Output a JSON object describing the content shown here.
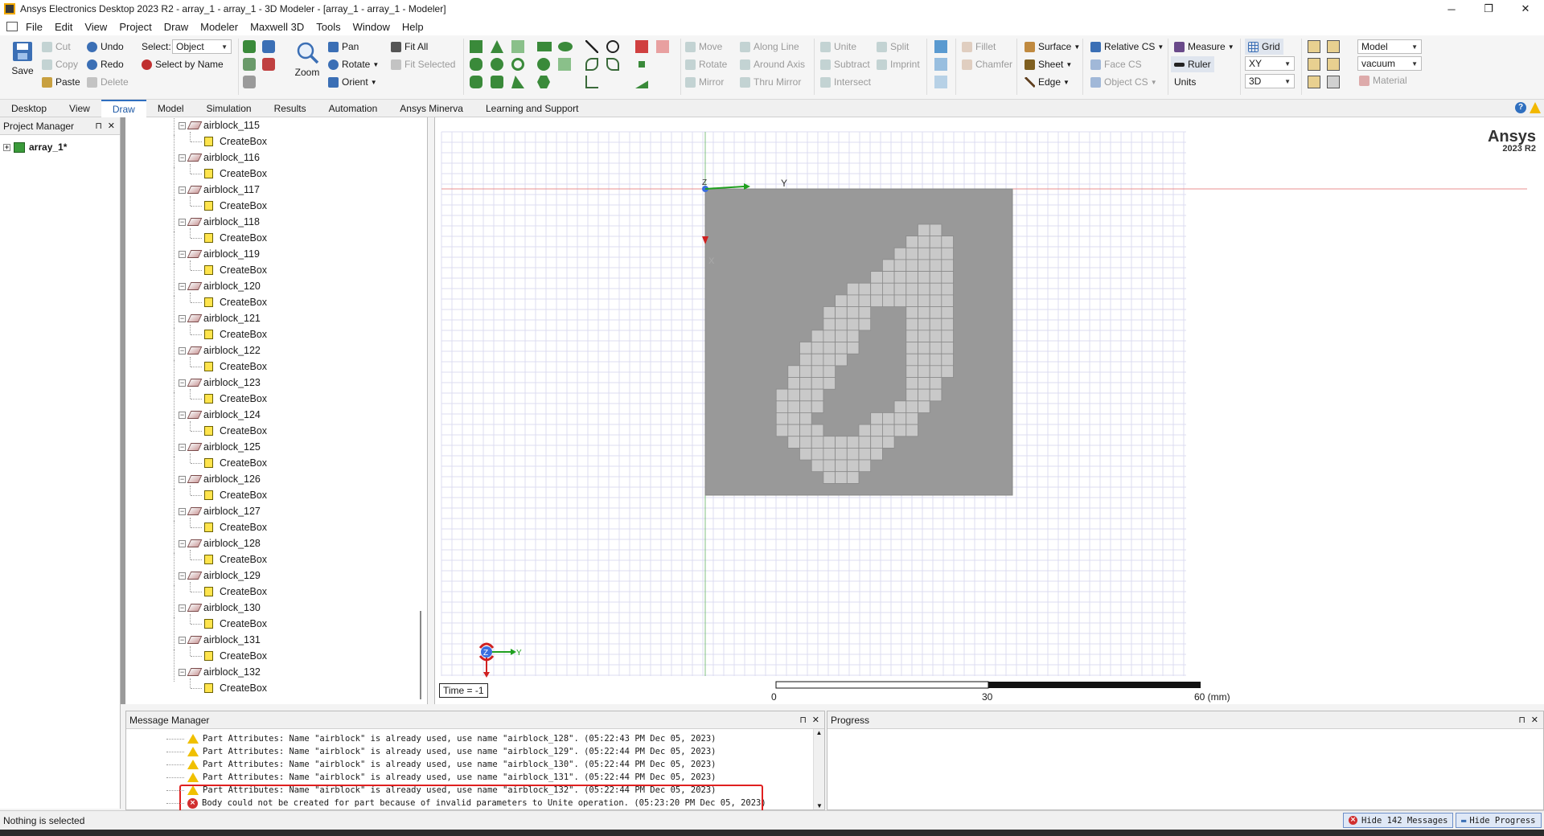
{
  "window": {
    "title": "Ansys Electronics Desktop 2023 R2 - array_1 - array_1 - 3D Modeler - [array_1 - array_1 - Modeler]",
    "minimize": "─",
    "restore": "❐",
    "close": "✕"
  },
  "menu": [
    "File",
    "Edit",
    "View",
    "Project",
    "Draw",
    "Modeler",
    "Maxwell 3D",
    "Tools",
    "Window",
    "Help"
  ],
  "ribbon": {
    "save": "Save",
    "cut": "Cut",
    "copy": "Copy",
    "paste": "Paste",
    "undo": "Undo",
    "redo": "Redo",
    "delete": "Delete",
    "select_label": "Select:",
    "select_value": "Object",
    "select_by_name": "Select by Name",
    "zoom": "Zoom",
    "pan": "Pan",
    "rotate": "Rotate",
    "orient": "Orient",
    "fit_all": "Fit All",
    "fit_selected": "Fit Selected",
    "move": "Move",
    "rotate2": "Rotate",
    "mirror": "Mirror",
    "along_line": "Along Line",
    "around_axis": "Around Axis",
    "thru_mirror": "Thru Mirror",
    "unite": "Unite",
    "subtract": "Subtract",
    "intersect": "Intersect",
    "split": "Split",
    "imprint": "Imprint",
    "fillet": "Fillet",
    "chamfer": "Chamfer",
    "surface": "Surface",
    "sheet": "Sheet",
    "edge": "Edge",
    "relative_cs": "Relative CS",
    "face_cs": "Face CS",
    "object_cs": "Object CS",
    "measure": "Measure",
    "ruler": "Ruler",
    "units": "Units",
    "grid": "Grid",
    "plane_value": "XY",
    "view_value": "3D",
    "model_value": "Model",
    "material_value": "vacuum",
    "material_label": "Material"
  },
  "tabs": [
    "Desktop",
    "View",
    "Draw",
    "Model",
    "Simulation",
    "Results",
    "Automation",
    "Ansys Minerva",
    "Learning and Support"
  ],
  "active_tab": "Draw",
  "project_manager": {
    "title": "Project Manager",
    "project": "array_1*"
  },
  "tree": {
    "items": [
      {
        "name": "airblock_115",
        "child": "CreateBox"
      },
      {
        "name": "airblock_116",
        "child": "CreateBox"
      },
      {
        "name": "airblock_117",
        "child": "CreateBox"
      },
      {
        "name": "airblock_118",
        "child": "CreateBox"
      },
      {
        "name": "airblock_119",
        "child": "CreateBox"
      },
      {
        "name": "airblock_120",
        "child": "CreateBox"
      },
      {
        "name": "airblock_121",
        "child": "CreateBox"
      },
      {
        "name": "airblock_122",
        "child": "CreateBox"
      },
      {
        "name": "airblock_123",
        "child": "CreateBox"
      },
      {
        "name": "airblock_124",
        "child": "CreateBox"
      },
      {
        "name": "airblock_125",
        "child": "CreateBox"
      },
      {
        "name": "airblock_126",
        "child": "CreateBox"
      },
      {
        "name": "airblock_127",
        "child": "CreateBox"
      },
      {
        "name": "airblock_128",
        "child": "CreateBox"
      },
      {
        "name": "airblock_129",
        "child": "CreateBox"
      },
      {
        "name": "airblock_130",
        "child": "CreateBox"
      },
      {
        "name": "airblock_131",
        "child": "CreateBox"
      },
      {
        "name": "airblock_132",
        "child": "CreateBox"
      }
    ]
  },
  "viewport": {
    "brand": "Ansys",
    "brand_version": "2023 R2",
    "time_label": "Time = -1",
    "axis_z": "Z",
    "axis_y": "Y",
    "axis_x": "X",
    "scale": [
      "0",
      "30",
      "60 (mm)"
    ],
    "pattern_rows": [
      "..........................",
      "..........................",
      "..........................",
      "..................##......",
      ".................####.....",
      "................#####.....",
      "...............######.....",
      "..............#######.....",
      "............#########.....",
      "...........##########.....",
      "..........####...####.....",
      "..........####...####.....",
      ".........####....####.....",
      "........#####....####.....",
      "........####.....####.....",
      ".......####......####.....",
      ".......####......###......",
      "......####.......###......",
      "......####......###.......",
      "......###.....####........",
      "......####...#####........",
      ".......#########..........",
      "........#######...........",
      ".........#####............",
      "..........###.............",
      ".........................."
    ]
  },
  "message_manager": {
    "title": "Message Manager",
    "messages": [
      {
        "type": "warning",
        "text": "Part Attributes: Name \"airblock\" is already used, use name \"airblock_128\". (05:22:43 PM  Dec 05, 2023)"
      },
      {
        "type": "warning",
        "text": "Part Attributes: Name \"airblock\" is already used, use name \"airblock_129\". (05:22:44 PM  Dec 05, 2023)"
      },
      {
        "type": "warning",
        "text": "Part Attributes: Name \"airblock\" is already used, use name \"airblock_130\". (05:22:44 PM  Dec 05, 2023)"
      },
      {
        "type": "warning",
        "text": "Part Attributes: Name \"airblock\" is already used, use name \"airblock_131\". (05:22:44 PM  Dec 05, 2023)"
      },
      {
        "type": "warning",
        "text": "Part Attributes: Name \"airblock\" is already used, use name \"airblock_132\". (05:22:44 PM  Dec 05, 2023)"
      },
      {
        "type": "error",
        "text": "Body could not be created for part because of invalid parameters to Unite operation. (05:23:20 PM  Dec 05, 2023)"
      }
    ]
  },
  "progress": {
    "title": "Progress"
  },
  "status": {
    "text": "Nothing is selected",
    "hide_messages": "Hide 142 Messages",
    "hide_progress": "Hide Progress"
  },
  "colors": {
    "accent": "#2f6fbf",
    "highlight_box": "#e02020",
    "part_fill": "#999999",
    "cell_fill": "#c9c9c9",
    "grid": "#dcdcf0"
  }
}
